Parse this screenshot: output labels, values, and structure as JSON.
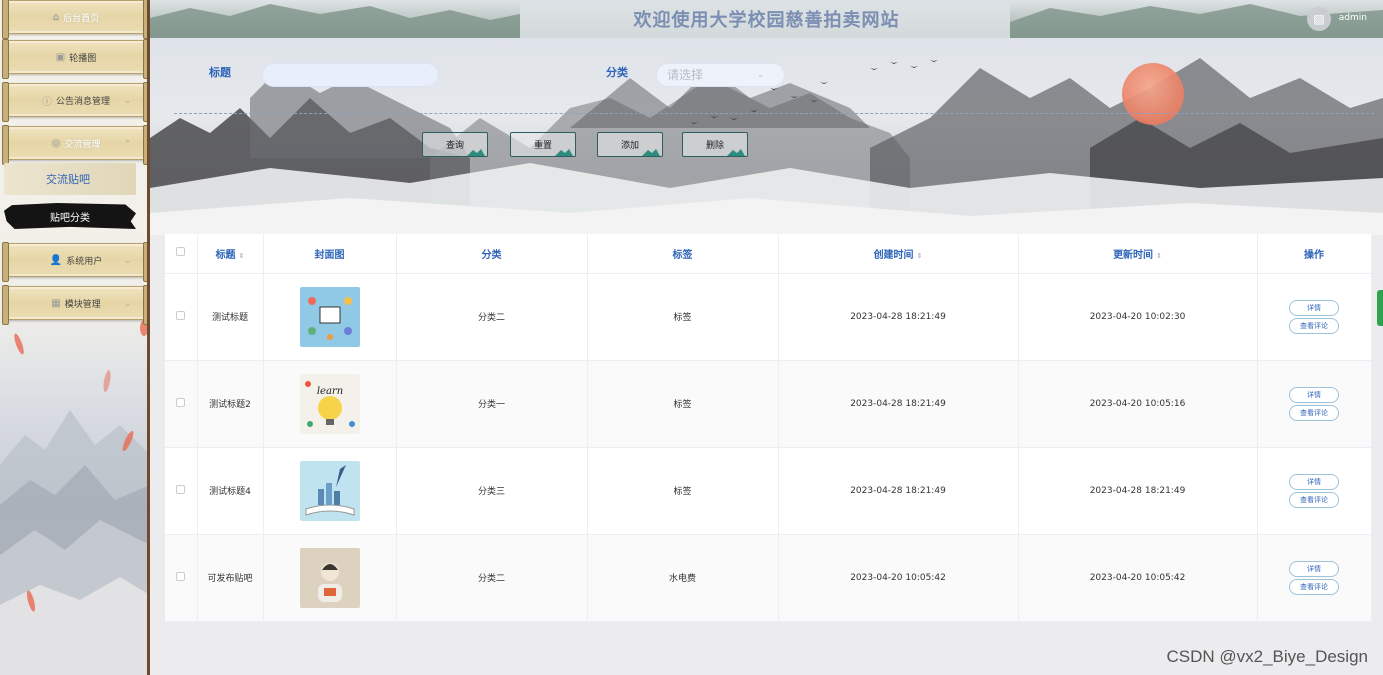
{
  "sidebar": {
    "items": [
      {
        "label": "后台首页",
        "icon": "home-icon"
      },
      {
        "label": "轮播图",
        "icon": "image-icon"
      },
      {
        "label": "公告消息管理",
        "icon": "info-icon"
      },
      {
        "label": "交流管理",
        "icon": "chat-icon"
      },
      {
        "label": "系统用户",
        "icon": "user-icon"
      },
      {
        "label": "模块管理",
        "icon": "grid-icon"
      }
    ],
    "sub_items": [
      {
        "label": "交流贴吧"
      },
      {
        "label": "贴吧分类"
      }
    ]
  },
  "header": {
    "title": "欢迎使用大学校园慈善拍卖网站",
    "user": "admin"
  },
  "search": {
    "title_label": "标题",
    "title_value": "",
    "category_label": "分类",
    "category_placeholder": "请选择",
    "buttons": {
      "query": "查询",
      "reset": "重置",
      "add": "添加",
      "delete": "删除"
    }
  },
  "table": {
    "columns": [
      "标题",
      "封面图",
      "分类",
      "标签",
      "创建时间",
      "更新时间",
      "操作"
    ],
    "rows": [
      {
        "title": "测试标题",
        "category": "分类二",
        "tag": "标签",
        "created": "2023-04-28 18:21:49",
        "updated": "2023-04-20 10:02:30"
      },
      {
        "title": "测试标题2",
        "category": "分类一",
        "tag": "标签",
        "created": "2023-04-28 18:21:49",
        "updated": "2023-04-20 10:05:16"
      },
      {
        "title": "测试标题4",
        "category": "分类三",
        "tag": "标签",
        "created": "2023-04-28 18:21:49",
        "updated": "2023-04-28 18:21:49"
      },
      {
        "title": "可发布贴吧",
        "category": "分类二",
        "tag": "水电费",
        "created": "2023-04-20 10:05:42",
        "updated": "2023-04-20 10:05:42"
      }
    ],
    "actions": {
      "detail": "详情",
      "comments": "查看评论"
    }
  },
  "watermark": "CSDN @vx2_Biye_Design",
  "colors": {
    "accent": "#2f65b9",
    "sun": "#e56c50",
    "sidebar_border": "#6e4b2e"
  }
}
